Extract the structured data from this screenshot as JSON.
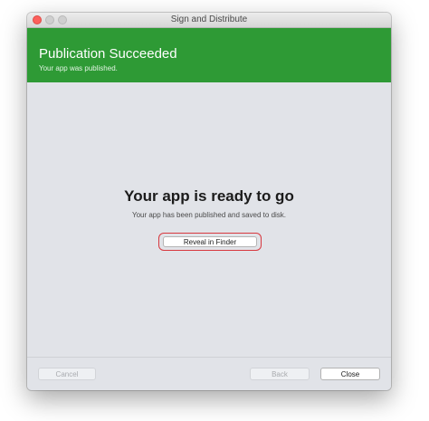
{
  "window": {
    "title": "Sign and Distribute"
  },
  "banner": {
    "title": "Publication Succeeded",
    "subtitle": "Your app was published.",
    "color": "#2e9a35"
  },
  "main": {
    "headline": "Your app is ready to go",
    "subline": "Your app has been published and saved to disk.",
    "reveal_label": "Reveal in Finder",
    "highlight_color": "#d7383f"
  },
  "footer": {
    "cancel_label": "Cancel",
    "back_label": "Back",
    "close_label": "Close"
  }
}
